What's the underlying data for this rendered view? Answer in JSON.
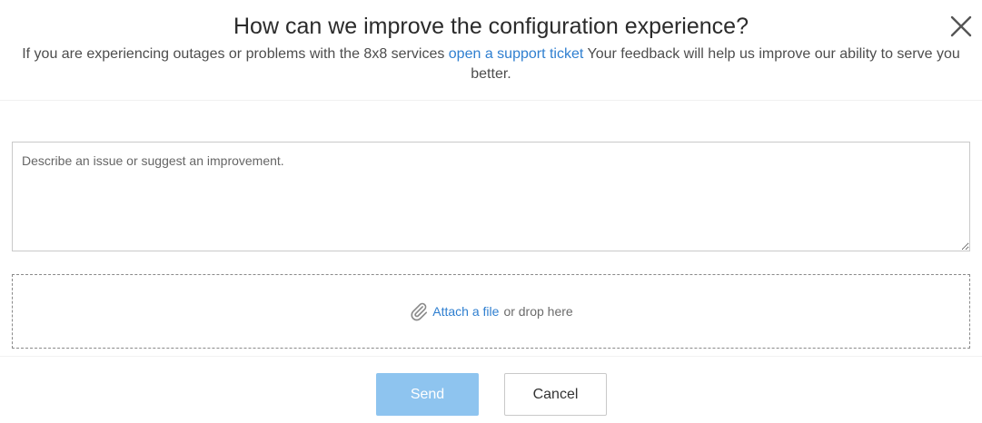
{
  "dialog": {
    "title": "How can we improve the configuration experience?",
    "subtitle_before": "If you are experiencing outages or problems with the 8x8 services ",
    "subtitle_link": "open a support ticket",
    "subtitle_after": " Your feedback will help us improve our ability to serve you better.",
    "close_icon": "close-icon"
  },
  "feedback": {
    "placeholder": "Describe an issue or suggest an improvement.",
    "value": ""
  },
  "attachment": {
    "icon": "paperclip-icon",
    "link_label": "Attach a file",
    "suffix": "or drop here"
  },
  "actions": {
    "send_label": "Send",
    "cancel_label": "Cancel"
  },
  "colors": {
    "link": "#2f7fd0",
    "send_button": "#8ec4ef",
    "title": "#2b2b2b"
  }
}
